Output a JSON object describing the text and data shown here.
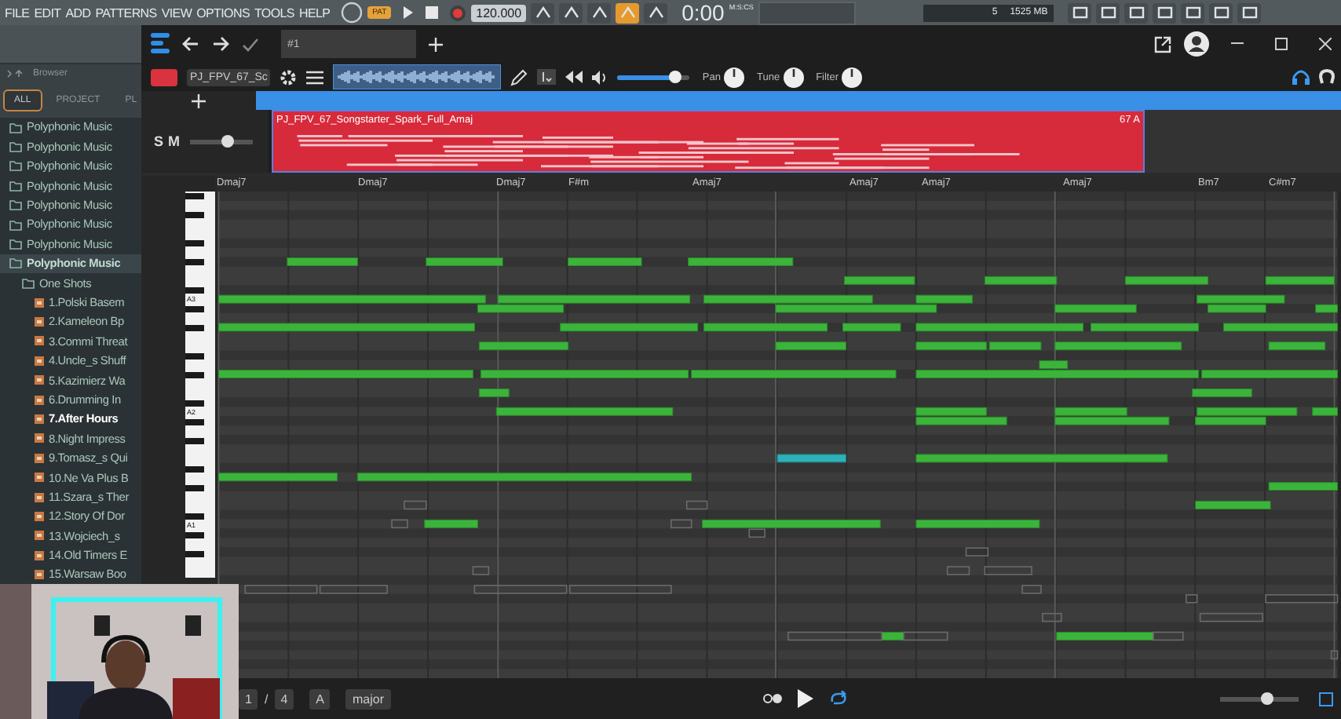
{
  "fl_menu": [
    "FILE",
    "EDIT",
    "ADD",
    "PATTERNS",
    "VIEW",
    "OPTIONS",
    "TOOLS",
    "HELP"
  ],
  "transport": {
    "pattern_badge": "PAT",
    "tempo": "120.000",
    "time": "0:00",
    "time_unit": "M:S:CS",
    "cpu": "5",
    "memory": "1525 MB"
  },
  "browser": {
    "title": "Browser",
    "tabs": [
      {
        "label": "ALL",
        "selected": true
      },
      {
        "label": "PROJECT",
        "selected": false
      },
      {
        "label": "PL",
        "selected": false
      }
    ],
    "items": [
      {
        "kind": "folder",
        "label": "Polyphonic Music",
        "expanded": false
      },
      {
        "kind": "folder",
        "label": "Polyphonic Music",
        "expanded": false
      },
      {
        "kind": "folder",
        "label": "Polyphonic Music",
        "expanded": false
      },
      {
        "kind": "folder",
        "label": "Polyphonic Music",
        "expanded": false
      },
      {
        "kind": "folder",
        "label": "Polyphonic Music",
        "expanded": false
      },
      {
        "kind": "folder",
        "label": "Polyphonic Music",
        "expanded": false
      },
      {
        "kind": "folder",
        "label": "Polyphonic Music",
        "expanded": false
      },
      {
        "kind": "folder",
        "label": "Polyphonic Music",
        "expanded": true,
        "children": [
          {
            "kind": "folder",
            "label": "One Shots",
            "expanded": true,
            "children": [
              {
                "kind": "file",
                "label": "1.Polski Basem",
                "selected": false
              },
              {
                "kind": "file",
                "label": "2.Kameleon Bp",
                "selected": false
              },
              {
                "kind": "file",
                "label": "3.Commi Threat",
                "selected": false
              },
              {
                "kind": "file",
                "label": "4.Uncle_s Shuff",
                "selected": false
              },
              {
                "kind": "file",
                "label": "5.Kazimierz Wa",
                "selected": false
              },
              {
                "kind": "file",
                "label": "6.Drumming In",
                "selected": false
              },
              {
                "kind": "file",
                "label": "7.After Hours",
                "selected": true
              },
              {
                "kind": "file",
                "label": "8.Night Impress",
                "selected": false
              },
              {
                "kind": "file",
                "label": "9.Tomasz_s Qui",
                "selected": false
              },
              {
                "kind": "file",
                "label": "10.Ne Va Plus B",
                "selected": false
              },
              {
                "kind": "file",
                "label": "11.Szara_s Ther",
                "selected": false
              },
              {
                "kind": "file",
                "label": "12.Story Of Dor",
                "selected": false
              },
              {
                "kind": "file",
                "label": "13.Wojciech_s",
                "selected": false
              },
              {
                "kind": "file",
                "label": "14.Old Timers E",
                "selected": false
              },
              {
                "kind": "file",
                "label": "15.Warsaw Boo",
                "selected": false
              }
            ]
          }
        ]
      }
    ]
  },
  "plugin": {
    "tab": "#1",
    "pattern_name": "PJ_FPV_67_Sc",
    "volume": {
      "level": 0.8
    },
    "knobs": [
      {
        "label": "Pan"
      },
      {
        "label": "Tune"
      },
      {
        "label": "Filter"
      }
    ],
    "track": {
      "solo": "S",
      "mute": "M",
      "level": 0.6
    },
    "clip": {
      "name": "PJ_FPV_67_Songstarter_Spark_Full_Amaj",
      "key": "67 A"
    },
    "chords": [
      "Dmaj7",
      "Dmaj7",
      "Dmaj7",
      "F#m",
      "Amaj7",
      "Amaj7",
      "Amaj7",
      "Amaj7",
      "Bm7",
      "C#m7"
    ],
    "octave_labels": [
      "A3",
      "A2",
      "A1"
    ],
    "footer": {
      "page": "1",
      "separator": "/",
      "pages": "4",
      "key": "A",
      "scale": "major",
      "zoom": {
        "level": 0.6
      }
    }
  }
}
